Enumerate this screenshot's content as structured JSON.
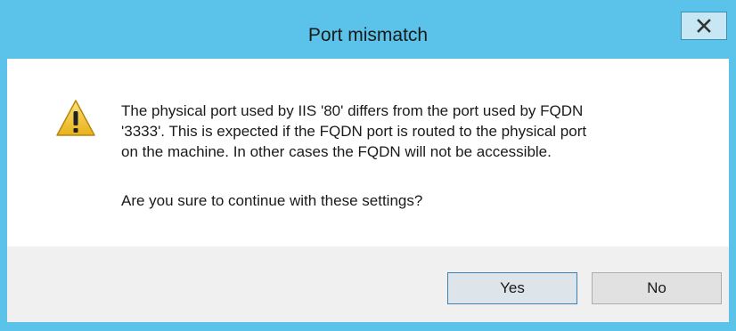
{
  "window": {
    "title": "Port mismatch",
    "close_label": "X"
  },
  "icons": {
    "warning": "warning-triangle-icon",
    "close": "close-icon"
  },
  "message": {
    "body": "The physical port used by IIS '80' differs from the port used by FQDN\n'3333'. This is expected if the FQDN port is routed to the physical port\non the machine. In other cases the FQDN will not be accessible.",
    "question": "Are you sure to continue with these settings?"
  },
  "buttons": {
    "yes_label": "Yes",
    "no_label": "No"
  },
  "colors": {
    "frame": "#5bc3ea",
    "warning": "#f5c518"
  }
}
